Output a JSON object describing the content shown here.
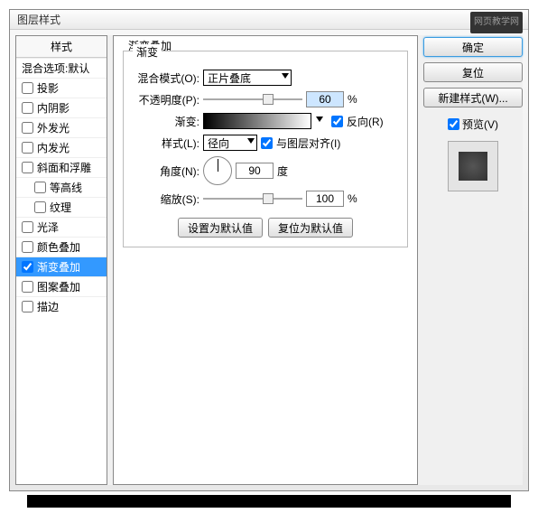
{
  "window": {
    "title": "图层样式",
    "watermark": "网页教学网"
  },
  "left": {
    "header": "样式",
    "items": [
      {
        "label": "混合选项:默认",
        "checked": null
      },
      {
        "label": "投影",
        "checked": false
      },
      {
        "label": "内阴影",
        "checked": false
      },
      {
        "label": "外发光",
        "checked": false
      },
      {
        "label": "内发光",
        "checked": false
      },
      {
        "label": "斜面和浮雕",
        "checked": false
      },
      {
        "label": "等高线",
        "checked": false,
        "indent": true
      },
      {
        "label": "纹理",
        "checked": false,
        "indent": true
      },
      {
        "label": "光泽",
        "checked": false
      },
      {
        "label": "颜色叠加",
        "checked": false
      },
      {
        "label": "渐变叠加",
        "checked": true,
        "selected": true
      },
      {
        "label": "图案叠加",
        "checked": false
      },
      {
        "label": "描边",
        "checked": false
      }
    ]
  },
  "mid": {
    "group_title": "渐变叠加",
    "sub_title": "渐变",
    "blend_label": "混合模式(O):",
    "blend_value": "正片叠底",
    "opacity_label": "不透明度(P):",
    "opacity_value": "60",
    "opacity_unit": "%",
    "opacity_thumb_pct": 60,
    "grad_label": "渐变:",
    "reverse_label": "反向(R)",
    "reverse_checked": true,
    "style_label": "样式(L):",
    "style_value": "径向",
    "align_label": "与图层对齐(I)",
    "align_checked": true,
    "angle_label": "角度(N):",
    "angle_value": "90",
    "angle_unit": "度",
    "scale_label": "缩放(S):",
    "scale_value": "100",
    "scale_unit": "%",
    "scale_thumb_pct": 60,
    "btn_set_default": "设置为默认值",
    "btn_reset_default": "复位为默认值"
  },
  "right": {
    "ok": "确定",
    "cancel": "复位",
    "newstyle": "新建样式(W)...",
    "preview_label": "预览(V)",
    "preview_checked": true
  }
}
